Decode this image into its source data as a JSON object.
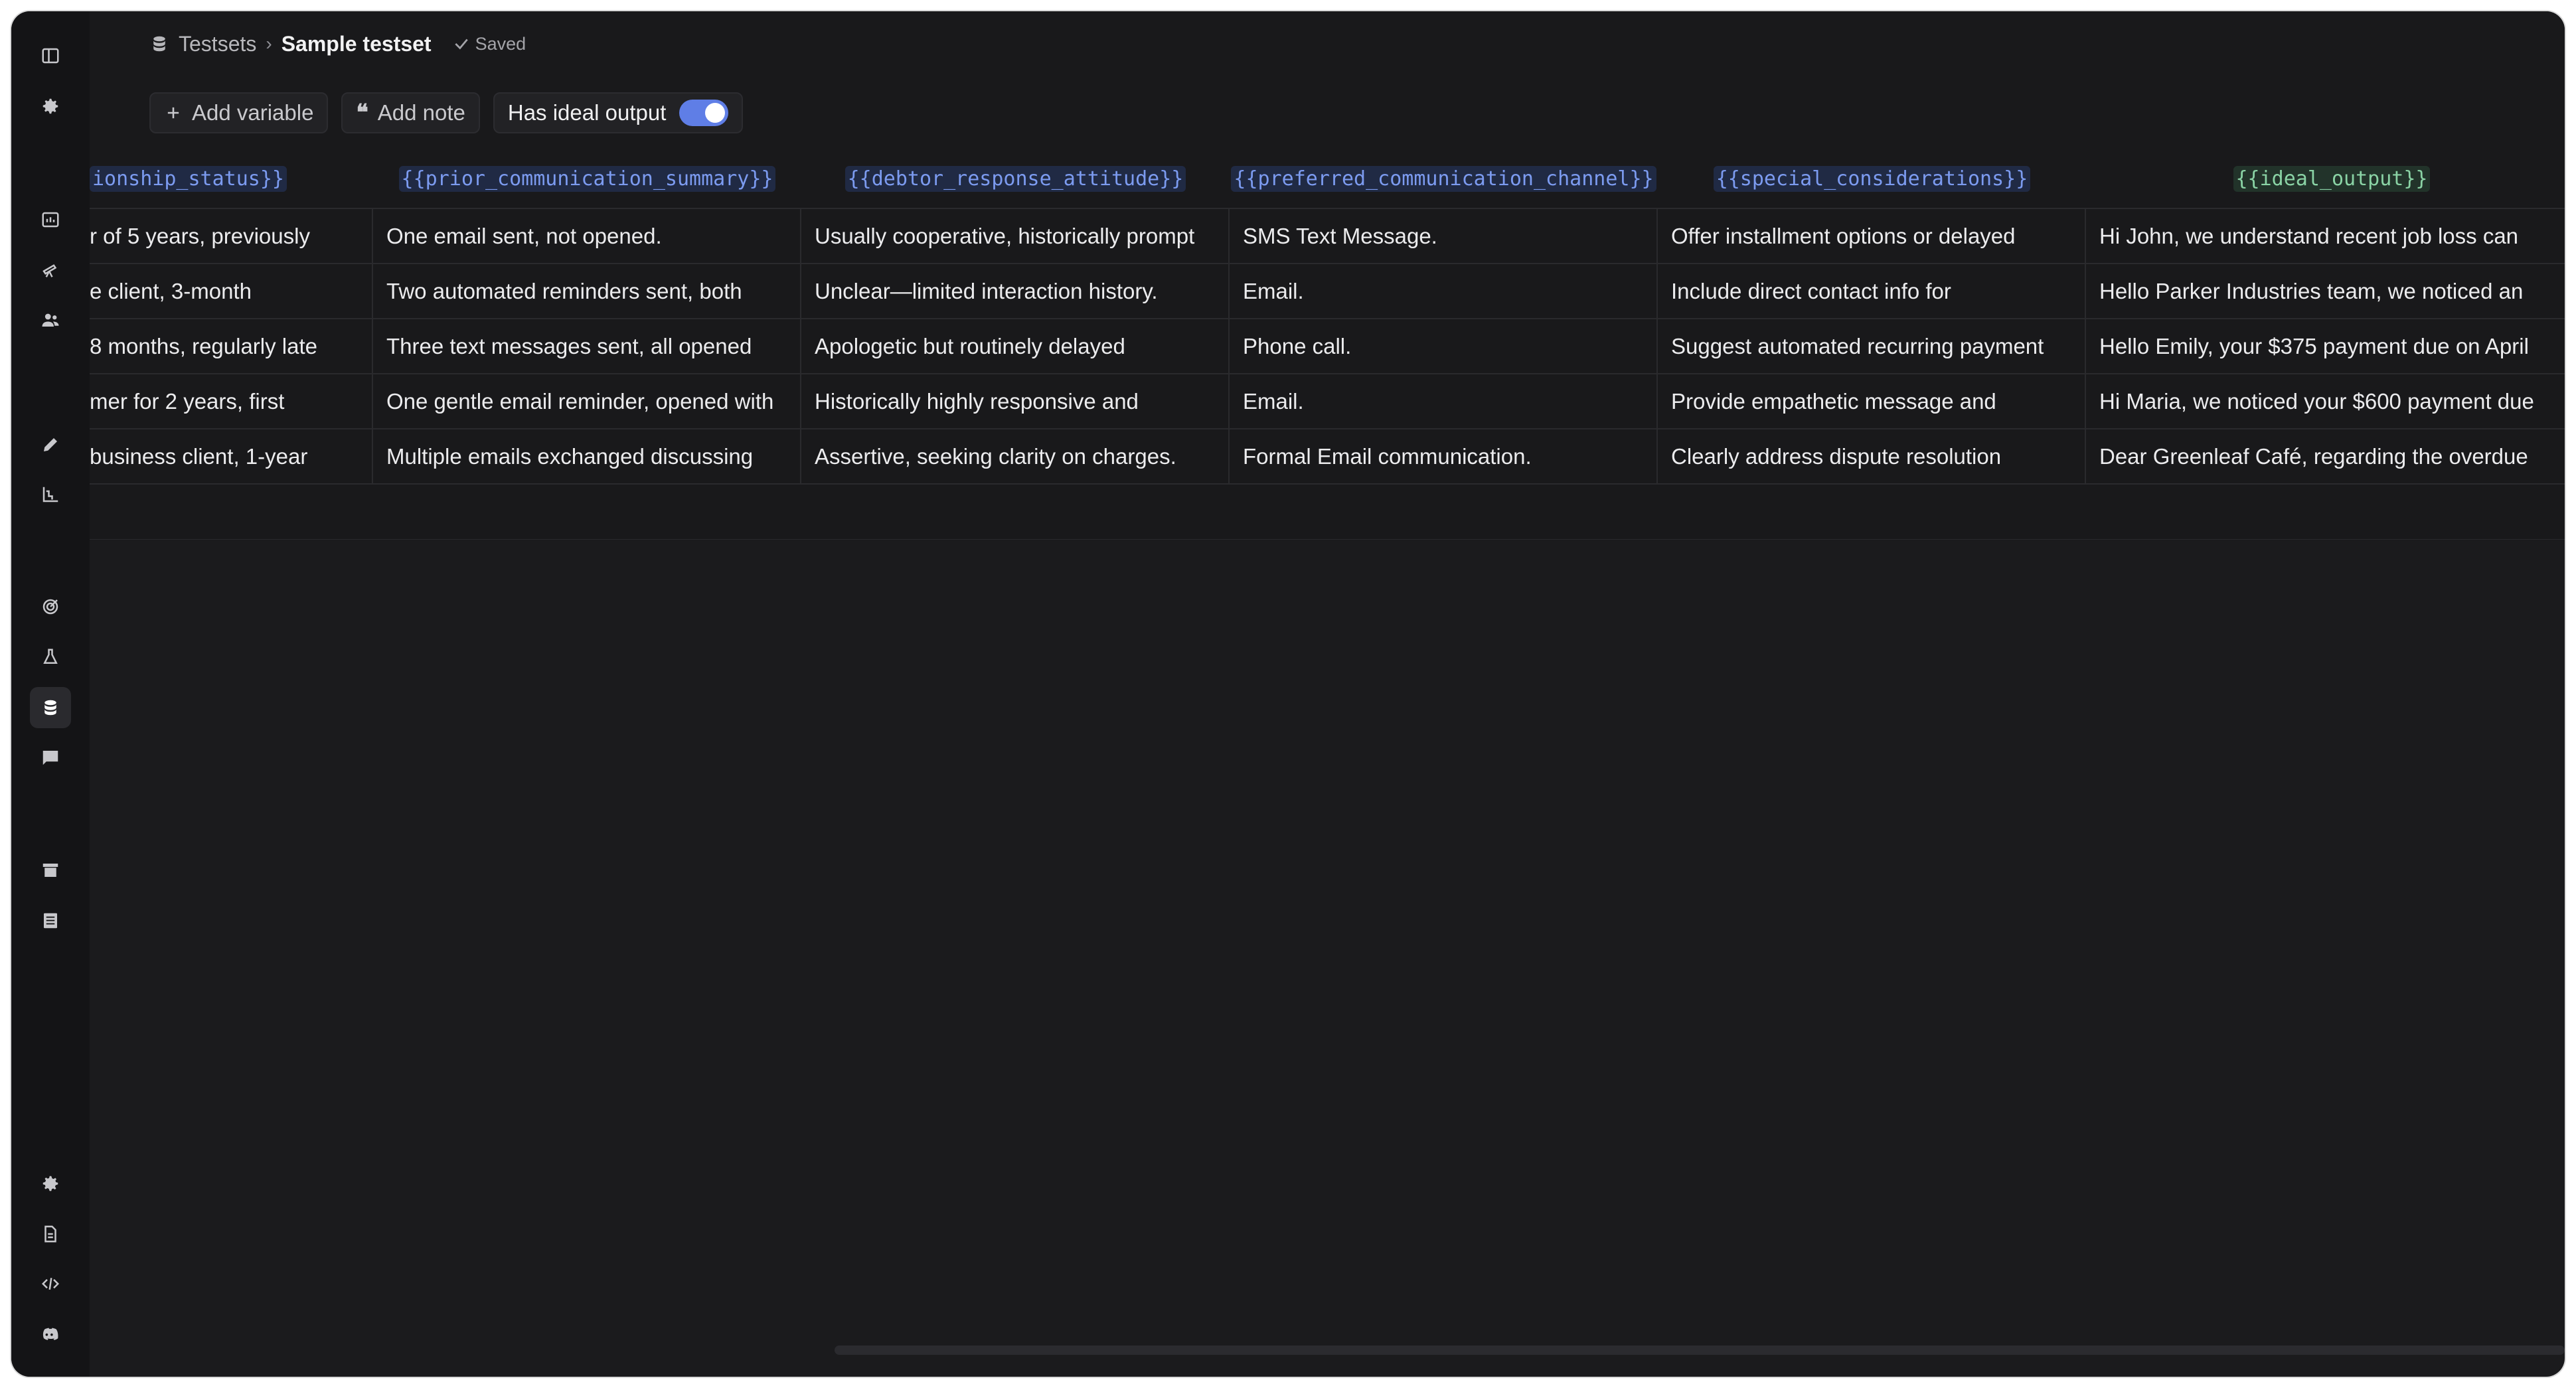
{
  "breadcrumb": {
    "root": "Testsets",
    "separator": "›",
    "current": "Sample testset",
    "status": "Saved"
  },
  "toolbar": {
    "add_variable": "Add variable",
    "add_note": "Add note",
    "ideal_output_label": "Has ideal output",
    "ideal_output_enabled": true
  },
  "sidebar": {
    "top_icons": [
      "panel-toggle-icon",
      "settings-icon"
    ],
    "group1_icons": [
      "dashboard-icon",
      "telescope-icon",
      "users-icon"
    ],
    "group2_icons": [
      "pencil-icon",
      "chart-icon"
    ],
    "group3_icons": [
      "target-icon",
      "flask-icon",
      "database-icon",
      "feedback-icon"
    ],
    "group4_icons": [
      "archive-icon",
      "table-icon"
    ],
    "bottom_icons": [
      "settings-icon",
      "document-icon",
      "code-icon",
      "discord-icon"
    ],
    "active": "database-icon"
  },
  "table": {
    "headers": [
      "ionship_status}}",
      "{{prior_communication_summary}}",
      "{{debtor_response_attitude}}",
      "{{preferred_communication_channel}}",
      "{{special_considerations}}",
      "{{ideal_output}}"
    ],
    "rows": [
      [
        "r of 5 years, previously",
        "One email sent, not opened.",
        "Usually cooperative, historically prompt",
        "SMS Text Message.",
        "Offer installment options or delayed",
        "Hi John, we understand recent job loss can"
      ],
      [
        "e client, 3-month",
        "Two automated reminders sent, both",
        "Unclear—limited interaction history.",
        "Email.",
        "Include direct contact info for",
        "Hello Parker Industries team, we noticed an"
      ],
      [
        "8 months, regularly late",
        "Three text messages sent, all opened",
        "Apologetic but routinely delayed",
        "Phone call.",
        "Suggest automated recurring payment",
        "Hello Emily, your $375 payment due on April"
      ],
      [
        "mer for 2 years, first",
        "One gentle email reminder, opened with",
        "Historically highly responsive and",
        "Email.",
        "Provide empathetic message and",
        "Hi Maria, we noticed your $600 payment due"
      ],
      [
        "business client, 1-year",
        "Multiple emails exchanged discussing",
        "Assertive, seeking clarity on charges.",
        "Formal Email communication.",
        "Clearly address dispute resolution",
        "Dear Greenleaf Café, regarding the overdue"
      ]
    ]
  },
  "colors": {
    "accent": "#5f7ee6",
    "variable_text": "#7c9bf0",
    "ideal_output_text": "#8ad3a5",
    "background": "#1b1b1d"
  }
}
